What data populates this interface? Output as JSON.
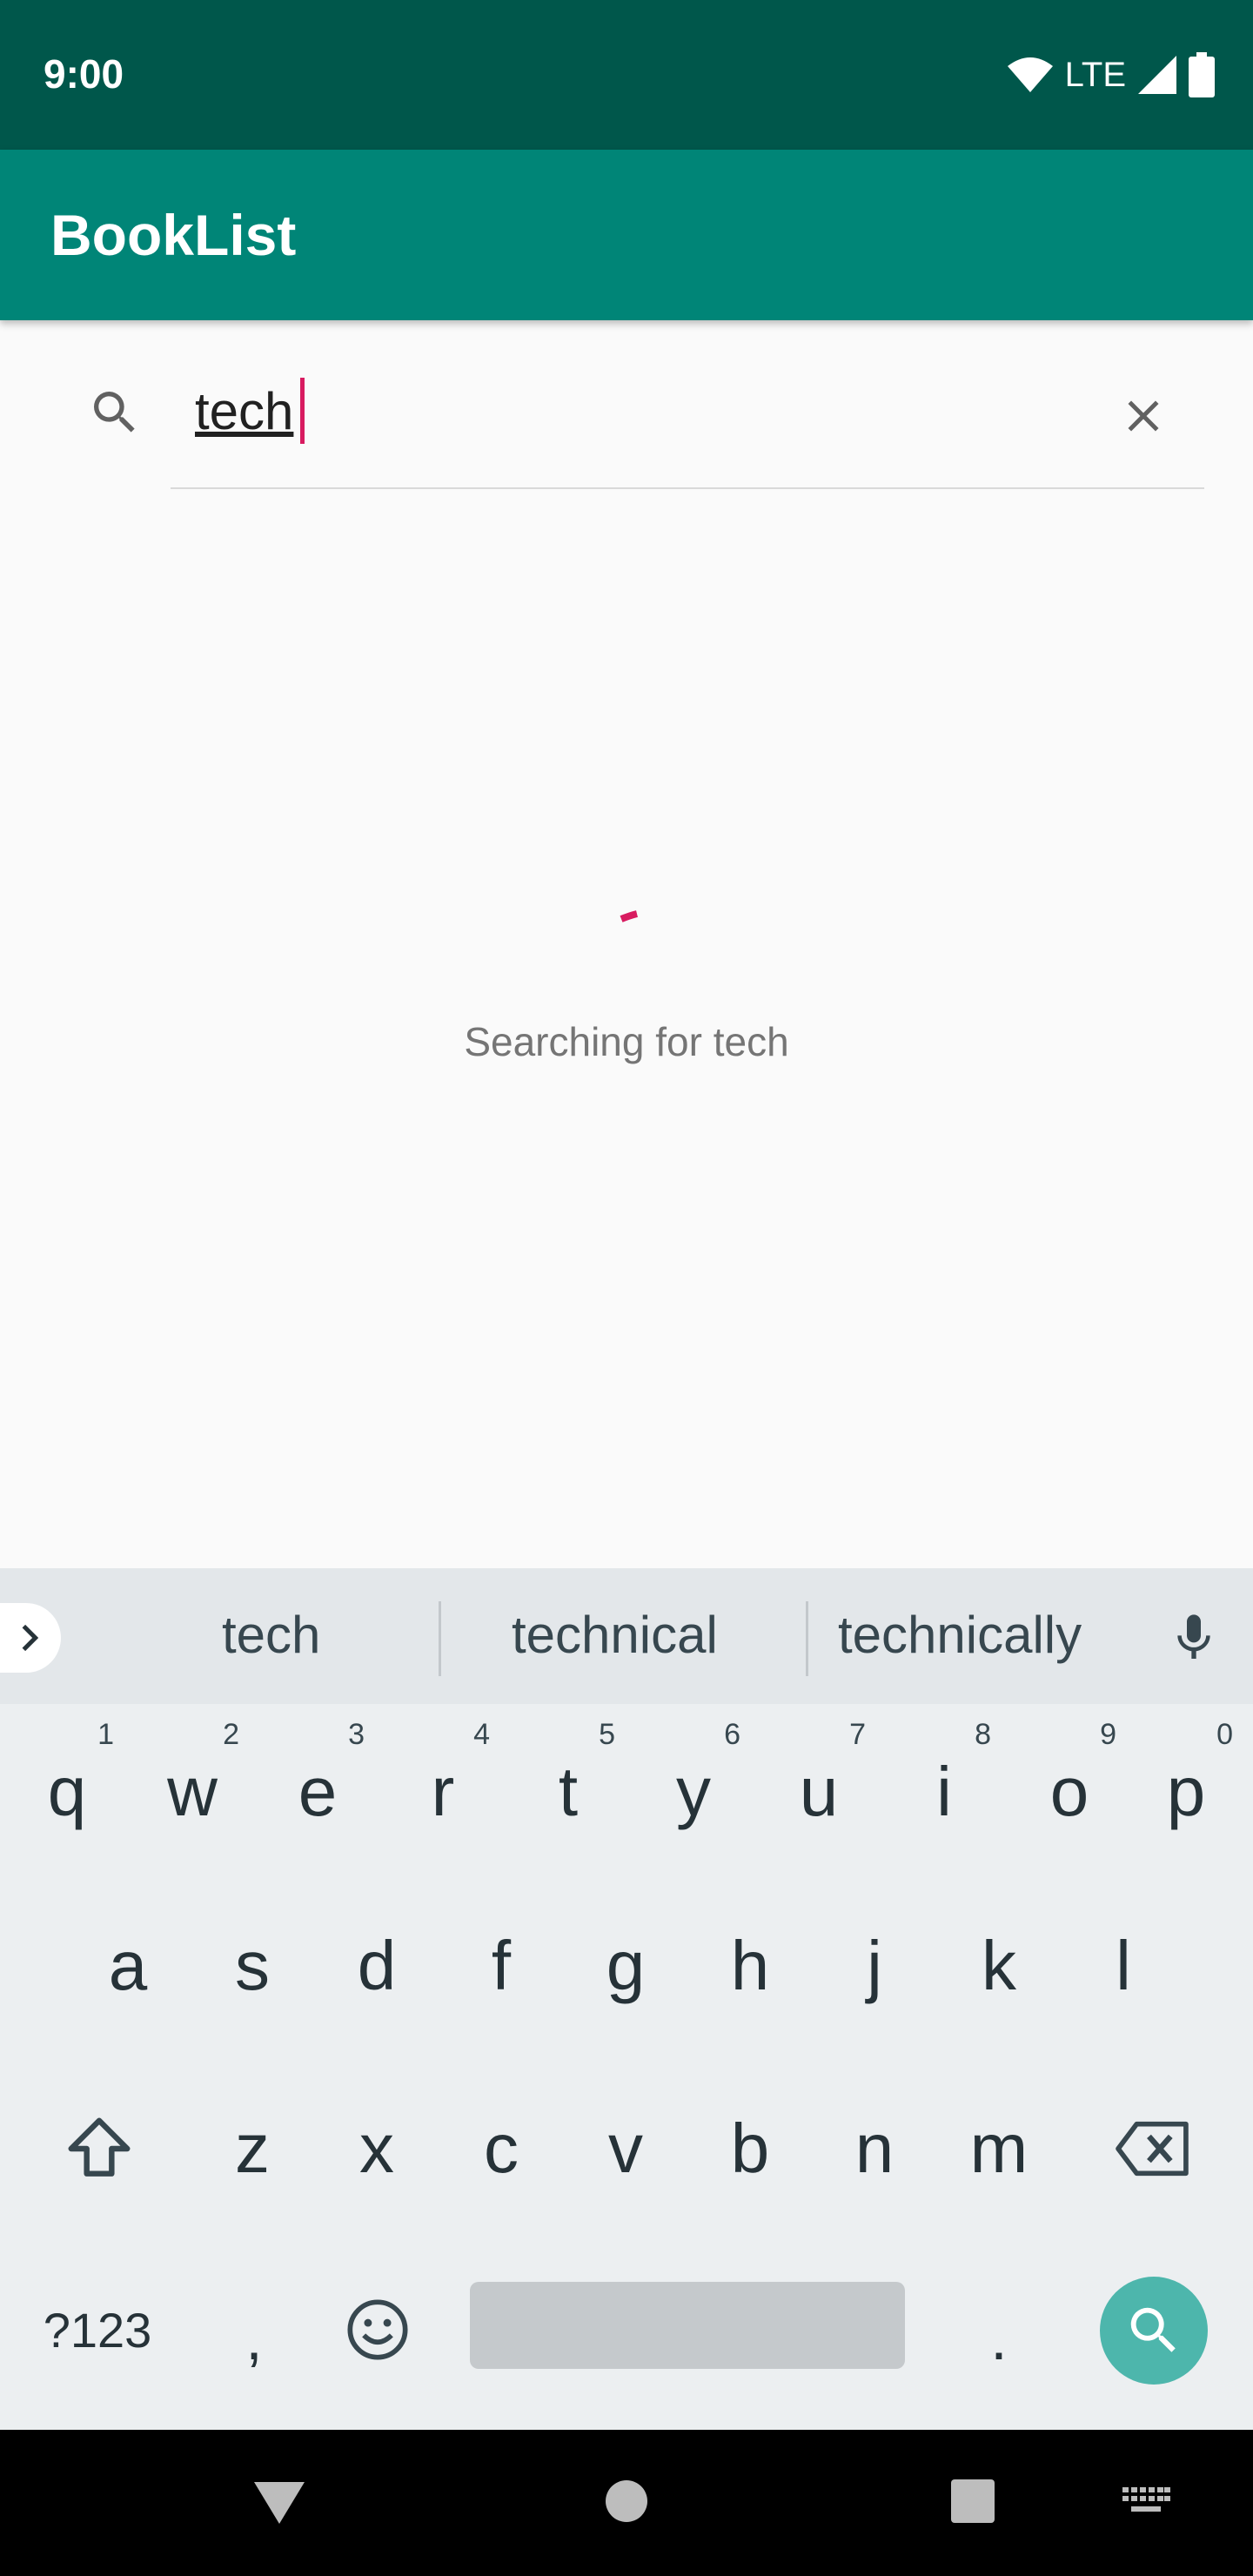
{
  "status_bar": {
    "time": "9:00",
    "network": "LTE"
  },
  "app_bar": {
    "title": "BookList"
  },
  "search": {
    "query": "tech"
  },
  "loading": {
    "message": "Searching for tech"
  },
  "keyboard": {
    "suggestions": [
      "tech",
      "technical",
      "technically"
    ],
    "row1": [
      {
        "key": "q",
        "hint": "1"
      },
      {
        "key": "w",
        "hint": "2"
      },
      {
        "key": "e",
        "hint": "3"
      },
      {
        "key": "r",
        "hint": "4"
      },
      {
        "key": "t",
        "hint": "5"
      },
      {
        "key": "y",
        "hint": "6"
      },
      {
        "key": "u",
        "hint": "7"
      },
      {
        "key": "i",
        "hint": "8"
      },
      {
        "key": "o",
        "hint": "9"
      },
      {
        "key": "p",
        "hint": "0"
      }
    ],
    "row2": [
      "a",
      "s",
      "d",
      "f",
      "g",
      "h",
      "j",
      "k",
      "l"
    ],
    "row3": [
      "z",
      "x",
      "c",
      "v",
      "b",
      "n",
      "m"
    ],
    "symbols_label": "?123",
    "comma": ",",
    "period": "."
  },
  "colors": {
    "accent": "#d81b60",
    "primary": "#008577",
    "primary_dark": "#00574b",
    "search_key": "#4db6ac"
  }
}
